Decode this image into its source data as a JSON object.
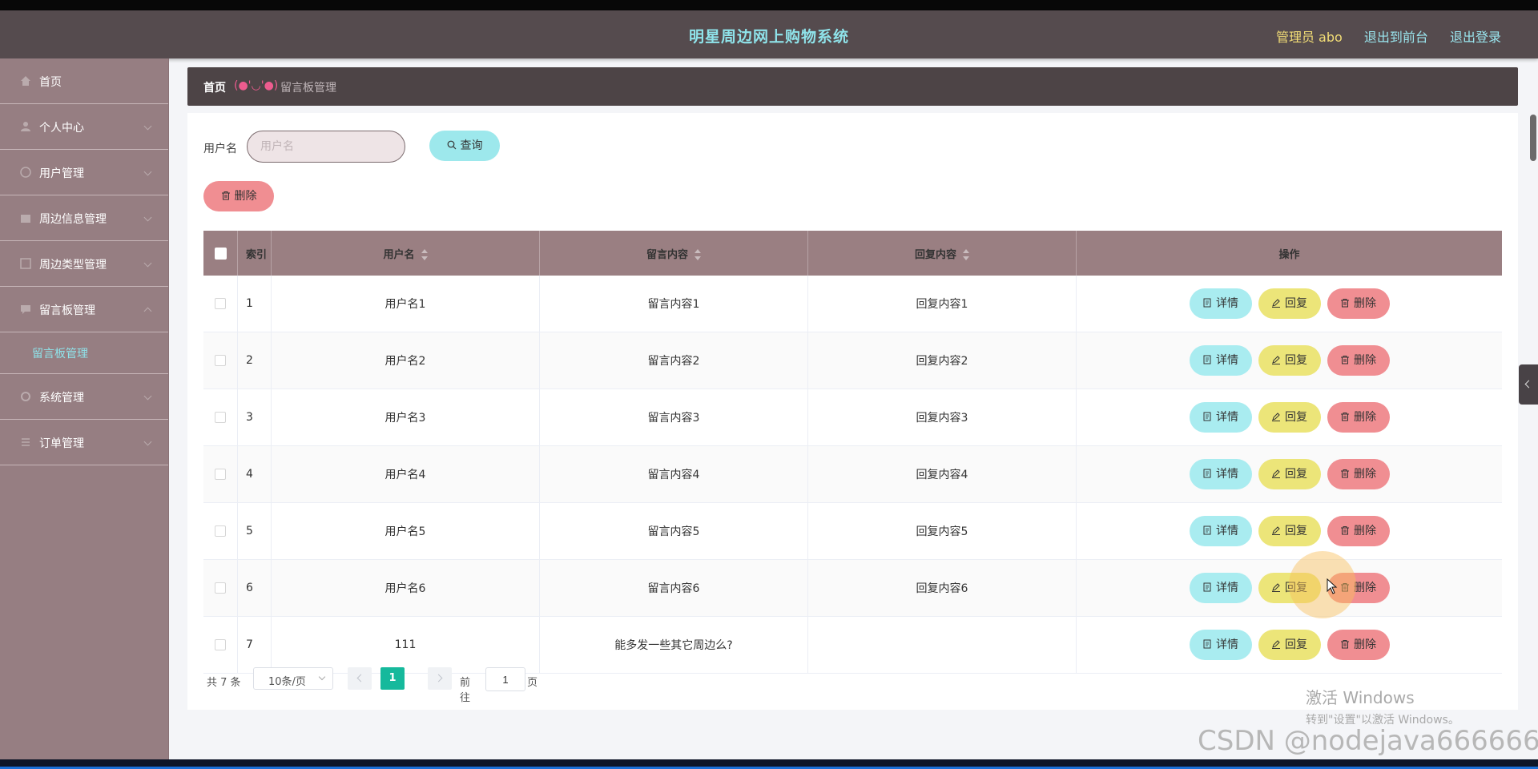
{
  "header": {
    "title": "明星周边网上购物系统",
    "admin": "管理员 abo",
    "to_front": "退出到前台",
    "logout": "退出登录"
  },
  "sidebar": {
    "items": [
      {
        "label": "首页",
        "icon": "home-icon",
        "has_arrow": false
      },
      {
        "label": "个人中心",
        "icon": "user-icon",
        "has_arrow": true
      },
      {
        "label": "用户管理",
        "icon": "users-icon",
        "has_arrow": true
      },
      {
        "label": "周边信息管理",
        "icon": "goods-icon",
        "has_arrow": true
      },
      {
        "label": "周边类型管理",
        "icon": "category-icon",
        "has_arrow": true
      },
      {
        "label": "留言板管理",
        "icon": "message-icon",
        "has_arrow": true
      },
      {
        "label": "系统管理",
        "icon": "settings-icon",
        "has_arrow": true
      },
      {
        "label": "订单管理",
        "icon": "order-icon",
        "has_arrow": true
      }
    ],
    "active_sub": "留言板管理"
  },
  "breadcrumb": {
    "home": "首页",
    "separator": "(●'◡'●)",
    "current": "留言板管理"
  },
  "search": {
    "label": "用户名",
    "placeholder": "用户名",
    "value": "",
    "query_button": "查询",
    "delete_button": "删除"
  },
  "table": {
    "columns": {
      "index": "索引",
      "username": "用户名",
      "content": "留言内容",
      "reply": "回复内容",
      "actions": "操作"
    },
    "rows": [
      {
        "index": "1",
        "username": "用户名1",
        "content": "留言内容1",
        "reply": "回复内容1"
      },
      {
        "index": "2",
        "username": "用户名2",
        "content": "留言内容2",
        "reply": "回复内容2"
      },
      {
        "index": "3",
        "username": "用户名3",
        "content": "留言内容3",
        "reply": "回复内容3"
      },
      {
        "index": "4",
        "username": "用户名4",
        "content": "留言内容4",
        "reply": "回复内容4"
      },
      {
        "index": "5",
        "username": "用户名5",
        "content": "留言内容5",
        "reply": "回复内容5"
      },
      {
        "index": "6",
        "username": "用户名6",
        "content": "留言内容6",
        "reply": "回复内容6"
      },
      {
        "index": "7",
        "username": "111",
        "content": "能多发一些其它周边么?",
        "reply": ""
      }
    ],
    "actions": {
      "detail": "详情",
      "reply": "回复",
      "delete": "删除"
    }
  },
  "pagination": {
    "total": "共 7 条",
    "page_size": "10条/页",
    "current_page": "1",
    "goto_label": "前往",
    "goto_value": "1",
    "page_suffix": "页"
  },
  "watermark": {
    "line1": "激活 Windows",
    "line2": "转到\"设置\"以激活 Windows。",
    "csdn": "CSDN @nodejava666666"
  },
  "colors": {
    "header_bg": "#554b4e",
    "sidebar_bg": "#967e82",
    "title": "#8fe3ea",
    "table_header": "#9a7f82",
    "detail_btn": "#a9ecf0",
    "reply_btn": "#ece579",
    "delete_btn": "#f08e92",
    "active_page": "#16b99c"
  }
}
